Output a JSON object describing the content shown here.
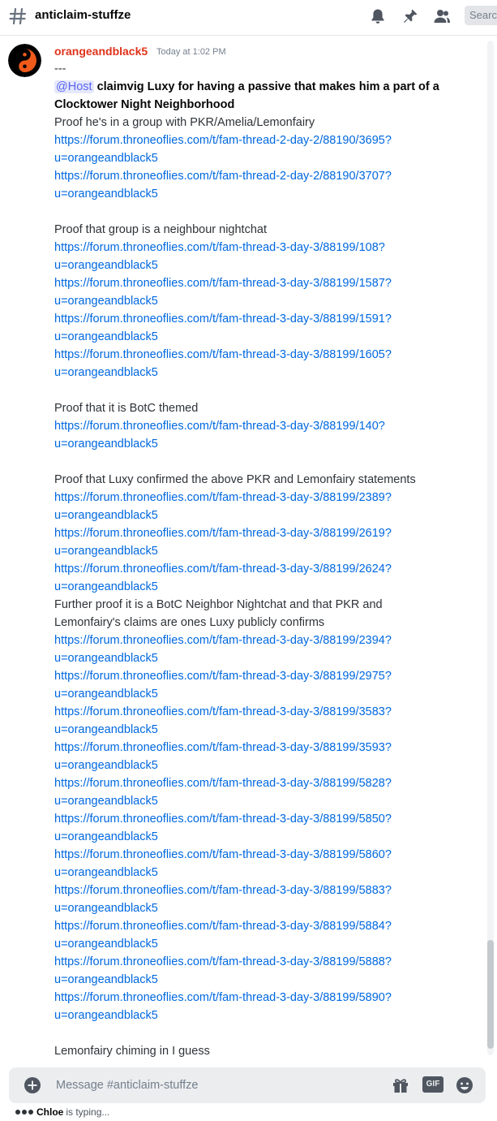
{
  "header": {
    "channel_name": "anticlaim-stuffze",
    "search_placeholder": "Search"
  },
  "message": {
    "author": "orangeandblack5",
    "timestamp": "Today at 1:02 PM",
    "separator": "---",
    "mention": "@Host",
    "claim_title": "claimvig Luxy for having a passive that makes him a part of a Clocktower Night Neighborhood",
    "sections": [
      {
        "heading": "Proof he's in a group with PKR/Amelia/Lemonfairy",
        "links": [
          [
            "https://forum.throneoflies.com/t/fam-thread-2-day-2/88190/3695?",
            "u=orangeandblack5"
          ],
          [
            "https://forum.throneoflies.com/t/fam-thread-2-day-2/88190/3707?",
            "u=orangeandblack5"
          ]
        ]
      },
      {
        "heading": "Proof that group is a neighbour nightchat",
        "links": [
          [
            "https://forum.throneoflies.com/t/fam-thread-3-day-3/88199/108?",
            "u=orangeandblack5"
          ],
          [
            "https://forum.throneoflies.com/t/fam-thread-3-day-3/88199/1587?",
            "u=orangeandblack5"
          ],
          [
            "https://forum.throneoflies.com/t/fam-thread-3-day-3/88199/1591?",
            "u=orangeandblack5"
          ],
          [
            "https://forum.throneoflies.com/t/fam-thread-3-day-3/88199/1605?",
            "u=orangeandblack5"
          ]
        ]
      },
      {
        "heading": "Proof that it is BotC themed",
        "links": [
          [
            "https://forum.throneoflies.com/t/fam-thread-3-day-3/88199/140?",
            "u=orangeandblack5"
          ]
        ]
      },
      {
        "heading": "Proof that Luxy confirmed the above PKR and Lemonfairy statements",
        "links": [
          [
            "https://forum.throneoflies.com/t/fam-thread-3-day-3/88199/2389?",
            "u=orangeandblack5"
          ],
          [
            "https://forum.throneoflies.com/t/fam-thread-3-day-3/88199/2619?",
            "u=orangeandblack5"
          ],
          [
            "https://forum.throneoflies.com/t/fam-thread-3-day-3/88199/2624?",
            "u=orangeandblack5"
          ]
        ]
      }
    ],
    "further_heading_1": "Further proof it is a BotC Neighbor Nightchat and that PKR and",
    "further_heading_2": "Lemonfairy's claims are ones Luxy publicly confirms",
    "further_links": [
      [
        "https://forum.throneoflies.com/t/fam-thread-3-day-3/88199/2394?",
        "u=orangeandblack5"
      ],
      [
        "https://forum.throneoflies.com/t/fam-thread-3-day-3/88199/2975?",
        "u=orangeandblack5"
      ],
      [
        "https://forum.throneoflies.com/t/fam-thread-3-day-3/88199/3583?",
        "u=orangeandblack5"
      ],
      [
        "https://forum.throneoflies.com/t/fam-thread-3-day-3/88199/3593?",
        "u=orangeandblack5"
      ],
      [
        "https://forum.throneoflies.com/t/fam-thread-3-day-3/88199/5828?",
        "u=orangeandblack5"
      ],
      [
        "https://forum.throneoflies.com/t/fam-thread-3-day-3/88199/5850?",
        "u=orangeandblack5"
      ],
      [
        "https://forum.throneoflies.com/t/fam-thread-3-day-3/88199/5860?",
        "u=orangeandblack5"
      ],
      [
        "https://forum.throneoflies.com/t/fam-thread-3-day-3/88199/5883?",
        "u=orangeandblack5"
      ],
      [
        "https://forum.throneoflies.com/t/fam-thread-3-day-3/88199/5884?",
        "u=orangeandblack5"
      ],
      [
        "https://forum.throneoflies.com/t/fam-thread-3-day-3/88199/5888?",
        "u=orangeandblack5"
      ],
      [
        "https://forum.throneoflies.com/t/fam-thread-3-day-3/88199/5890?",
        "u=orangeandblack5"
      ]
    ],
    "closing": "Lemonfairy chiming in I guess"
  },
  "composer": {
    "placeholder": "Message #anticlaim-stuffze",
    "gif_label": "GIF"
  },
  "typing": {
    "user": "Chloe",
    "suffix": "is typing..."
  },
  "colors": {
    "author": "#e0321a",
    "link": "#0068e0",
    "mention": "#5865f2"
  },
  "icons": [
    "hash-icon",
    "bell-icon",
    "pin-icon",
    "members-icon",
    "add-icon",
    "gift-icon",
    "gif-icon",
    "emoji-icon"
  ]
}
